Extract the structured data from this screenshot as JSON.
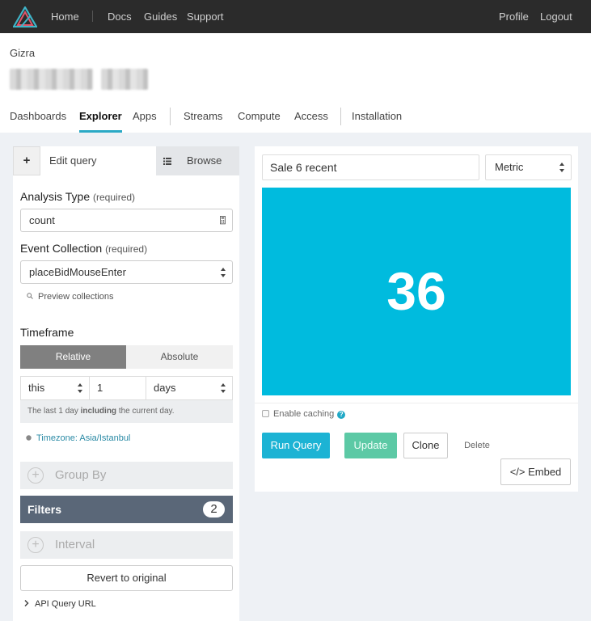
{
  "navbar": {
    "home": "Home",
    "docs": "Docs",
    "guides": "Guides",
    "support": "Support",
    "profile": "Profile",
    "logout": "Logout"
  },
  "header": {
    "org_name": "Gizra",
    "tabs": [
      "Dashboards",
      "Explorer",
      "Apps",
      "Streams",
      "Compute",
      "Access",
      "Installation"
    ],
    "active_tab": "Explorer"
  },
  "left_panel": {
    "plus_label": "+",
    "edit_tab": "Edit query",
    "browse_tab": "Browse",
    "analysis_type": {
      "label": "Analysis Type",
      "required": "(required)",
      "value": "count"
    },
    "event_collection": {
      "label": "Event Collection",
      "required": "(required)",
      "value": "placeBidMouseEnter"
    },
    "preview_collections": "Preview collections",
    "timeframe": {
      "label": "Timeframe",
      "relative": "Relative",
      "absolute": "Absolute",
      "selected": "Relative",
      "relativity": "this",
      "amount": "1",
      "unit": "days",
      "note_pre": "The last 1 day ",
      "note_bold": "including",
      "note_post": " the current day."
    },
    "timezone": "Timezone: Asia/Istanbul",
    "group_by": "Group By",
    "filters": {
      "label": "Filters",
      "count": "2"
    },
    "interval": "Interval",
    "revert": "Revert to original",
    "api_query_url": "API Query URL"
  },
  "right_panel": {
    "query_name": "Sale 6 recent",
    "viz_type": "Metric",
    "metric_value": "36",
    "metric_color": "#00bbde",
    "enable_caching": "Enable caching",
    "caching_help": "?",
    "run_query": "Run Query",
    "update": "Update",
    "clone": "Clone",
    "delete": "Delete",
    "embed": "</> Embed"
  }
}
